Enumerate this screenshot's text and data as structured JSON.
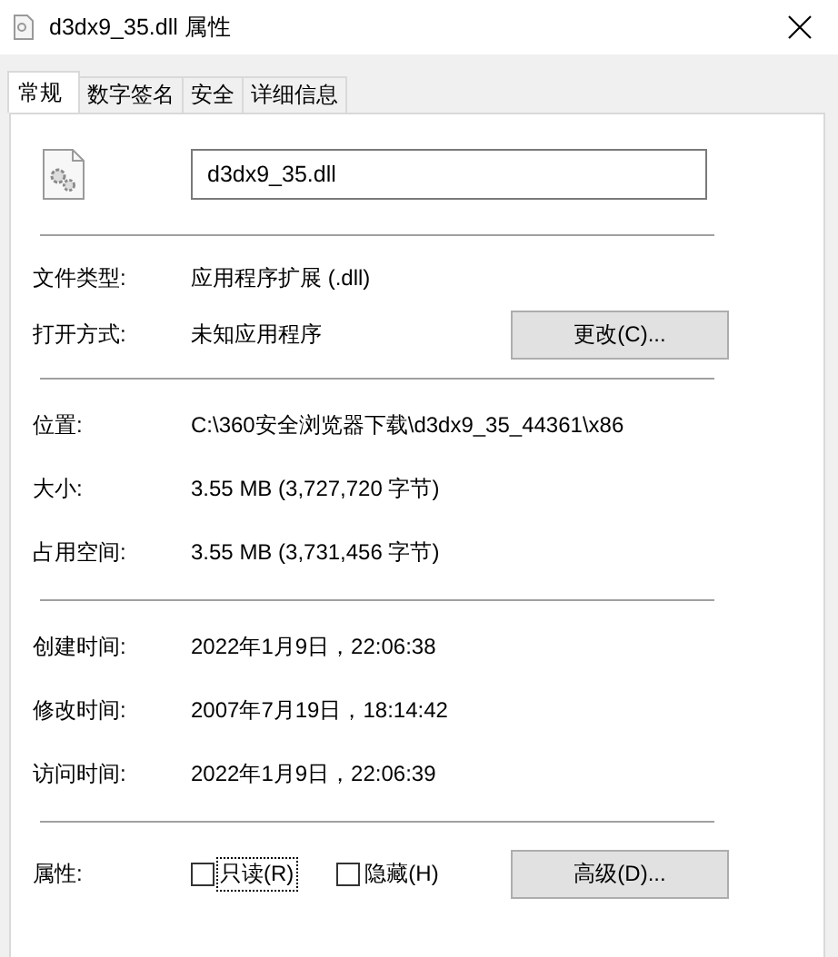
{
  "window": {
    "title": "d3dx9_35.dll 属性"
  },
  "tabs": [
    {
      "label": "常规",
      "selected": true
    },
    {
      "label": "数字签名",
      "selected": false
    },
    {
      "label": "安全",
      "selected": false
    },
    {
      "label": "详细信息",
      "selected": false
    }
  ],
  "file_name": {
    "value": "d3dx9_35.dll"
  },
  "type_section": [
    {
      "label": "文件类型:",
      "value": "应用程序扩展 (.dll)"
    },
    {
      "label": "打开方式:",
      "value": "未知应用程序",
      "button": "更改(C)..."
    }
  ],
  "location_section": [
    {
      "label": "位置:",
      "value": "C:\\360安全浏览器下载\\d3dx9_35_44361\\x86"
    },
    {
      "label": "大小:",
      "value": "3.55 MB (3,727,720 字节)"
    },
    {
      "label": "占用空间:",
      "value": "3.55 MB (3,731,456 字节)"
    }
  ],
  "time_section": [
    {
      "label": "创建时间:",
      "value": "2022年1月9日，22:06:38"
    },
    {
      "label": "修改时间:",
      "value": "2007年7月19日，18:14:42"
    },
    {
      "label": "访问时间:",
      "value": "2022年1月9日，22:06:39"
    }
  ],
  "attributes": {
    "label": "属性:",
    "checkboxes": [
      {
        "label": "只读(R)",
        "checked": false,
        "focused": true
      },
      {
        "label": "隐藏(H)",
        "checked": false,
        "focused": false
      }
    ],
    "button": "高级(D)..."
  }
}
